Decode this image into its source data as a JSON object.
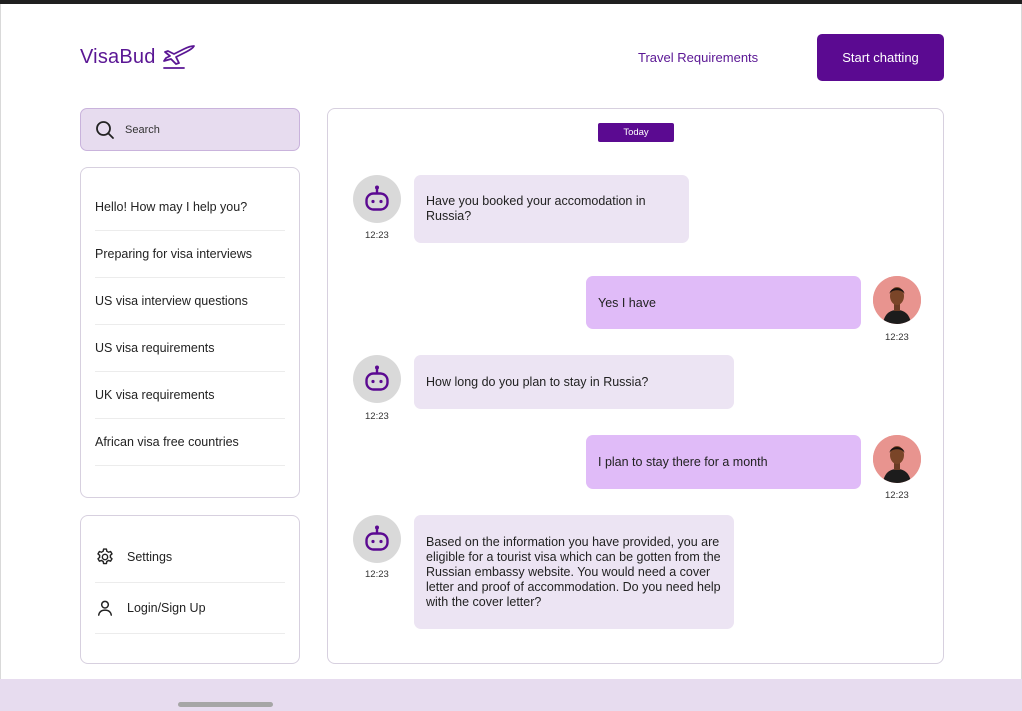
{
  "brand": {
    "name": "VisaBud",
    "icon": "airplane-icon"
  },
  "nav": {
    "travel_requirements": "Travel Requirements",
    "start_chatting": "Start chatting"
  },
  "search": {
    "placeholder": "Search",
    "icon": "search-icon"
  },
  "history": {
    "items": [
      {
        "label": "Hello! How may I help you?"
      },
      {
        "label": "Preparing for visa interviews"
      },
      {
        "label": "US visa interview questions"
      },
      {
        "label": "US visa requirements"
      },
      {
        "label": "UK visa requirements"
      },
      {
        "label": "African visa free countries"
      }
    ]
  },
  "settings": {
    "items": [
      {
        "label": "Settings",
        "icon": "gear-icon"
      },
      {
        "label": "Login/Sign Up",
        "icon": "user-icon"
      }
    ]
  },
  "chat": {
    "date_badge": "Today",
    "messages": [
      {
        "sender": "bot",
        "text": "Have you booked your accomodation in Russia?",
        "time": "12:23"
      },
      {
        "sender": "user",
        "text": "Yes I have",
        "time": "12:23"
      },
      {
        "sender": "bot",
        "text": "How long do you plan to stay in Russia?",
        "time": "12:23"
      },
      {
        "sender": "user",
        "text": "I plan to stay there for a month",
        "time": "12:23"
      },
      {
        "sender": "bot",
        "text": "Based on the information you have provided, you are eligible for a tourist visa which can be gotten from the Russian embassy website. You would need a cover letter and proof of accommodation. Do you need help with the cover letter?",
        "time": "12:23"
      }
    ]
  },
  "colors": {
    "brand": "#5b0a91",
    "bot_bubble": "#ece4f3",
    "user_bubble": "#e0bbf8",
    "search_bg": "#e7dcef"
  }
}
